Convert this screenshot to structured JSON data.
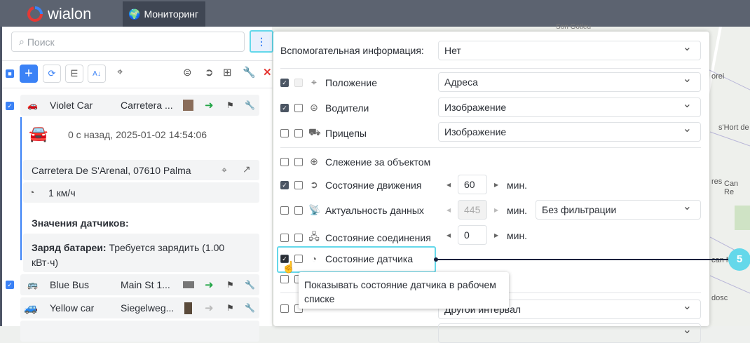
{
  "header": {
    "logo": "wialon",
    "tab": "Мониторинг"
  },
  "left": {
    "search_placeholder": "Поиск",
    "units": [
      {
        "name": "Violet Car",
        "address": "Carretera ...",
        "checked": true,
        "color": "#8e2fc9"
      },
      {
        "name": "Blue Bus",
        "address": "Main St 1...",
        "checked": true,
        "color": "#2563a8"
      },
      {
        "name": "Yellow car",
        "address": "Siegelweg...",
        "checked": false,
        "color": "#e6a817"
      }
    ],
    "detail": {
      "time": "0 с назад, 2025-01-02 14:54:06",
      "address": "Carretera De S'Arenal, 07610 Palma",
      "speed": "1 км/ч",
      "sensors_title": "Значения датчиков:",
      "sensor_name": "Заряд батареи:",
      "sensor_value": "Требуется зарядить (1.00 кВт·ч)"
    }
  },
  "panel": {
    "info_label": "Вспомогательная информация:",
    "info_value": "Нет",
    "rows": [
      {
        "label": "Положение",
        "value": "Адреса"
      },
      {
        "label": "Водители",
        "value": "Изображение"
      },
      {
        "label": "Прицепы",
        "value": "Изображение"
      },
      {
        "label": "Слежение за объектом"
      },
      {
        "label": "Состояние движения",
        "num": "60",
        "unit": "мин."
      },
      {
        "label": "Актуальность данных",
        "num": "445",
        "unit": "мин.",
        "value": "Без фильтрации"
      },
      {
        "label": "Состояние соединения",
        "num": "0",
        "unit": "мин."
      },
      {
        "label": "Состояние датчика"
      }
    ],
    "track_value": "Другой интервал",
    "tooltip": "Показывать состояние датчика в рабочем списке"
  },
  "map": {
    "labels": [
      "Son Gotleu",
      "orei",
      "s'Hort de",
      "res",
      "Can Re",
      "can M",
      "dosc"
    ]
  },
  "callout": {
    "number": "5",
    "color": "#64d8ea"
  }
}
